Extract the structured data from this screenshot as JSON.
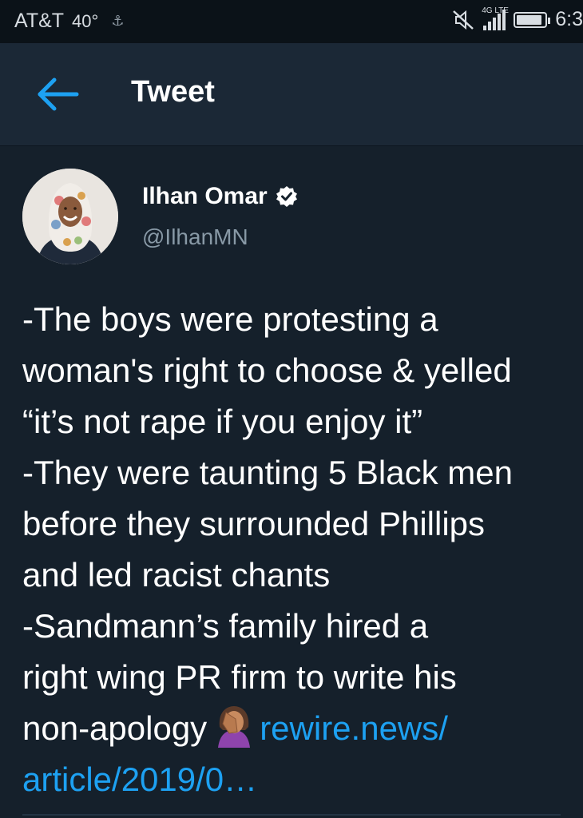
{
  "status_bar": {
    "carrier": "AT&T",
    "temperature": "40°",
    "usb_icon": "usb-icon",
    "network": "4G LTE",
    "time": "6:3",
    "battery_level": 0.9
  },
  "header": {
    "title": "Tweet",
    "back_icon": "arrow-left-icon"
  },
  "tweet": {
    "author_name": "Ilhan Omar",
    "verified": true,
    "handle": "@IlhanMN",
    "lines": {
      "l1": "-The boys were protesting a",
      "l2": "woman's right to choose & yelled",
      "l3": "“it’s not rape if you enjoy it”",
      "l4": "-They were taunting 5 Black men",
      "l5": "before they surrounded Phillips",
      "l6": "and led racist chants",
      "l7": "-Sandmann’s family hired a",
      "l8": "right wing PR firm to write his",
      "l9": "non-apology"
    },
    "emoji": "woman-facepalming-icon",
    "link_line1": "rewire.news/",
    "link_line2": "article/2019/0…"
  },
  "colors": {
    "background": "#15202b",
    "header": "#1b2836",
    "accent": "#1da1f2",
    "secondary_text": "#8899a6"
  }
}
